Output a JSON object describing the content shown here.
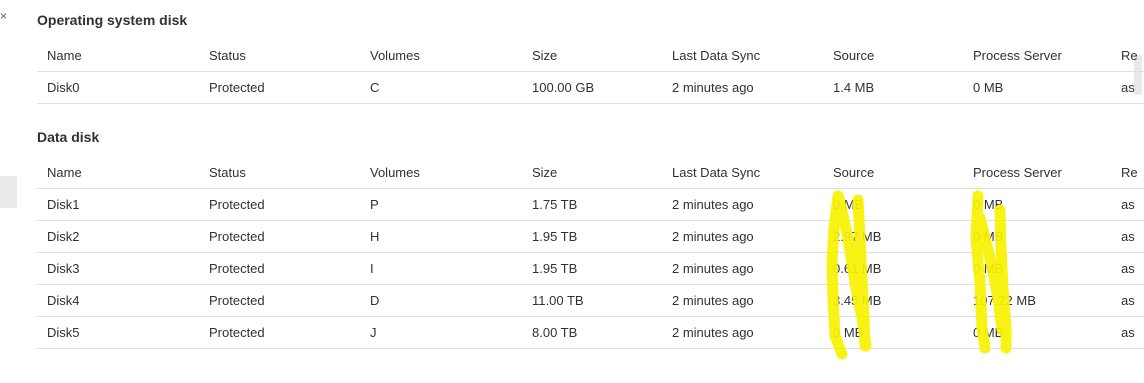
{
  "close_glyph": "×",
  "os_disk": {
    "title": "Operating system disk",
    "columns": [
      "Name",
      "Status",
      "Volumes",
      "Size",
      "Last Data Sync",
      "Source",
      "Process Server",
      "Re"
    ],
    "rows": [
      [
        "Disk0",
        "Protected",
        "C",
        "100.00 GB",
        "2 minutes ago",
        "1.4 MB",
        "0 MB",
        "as"
      ]
    ]
  },
  "data_disk": {
    "title": "Data disk",
    "columns": [
      "Name",
      "Status",
      "Volumes",
      "Size",
      "Last Data Sync",
      "Source",
      "Process Server",
      "Re"
    ],
    "rows": [
      [
        "Disk1",
        "Protected",
        "P",
        "1.75 TB",
        "2 minutes ago",
        "0 MB",
        "0 MB",
        "as"
      ],
      [
        "Disk2",
        "Protected",
        "H",
        "1.95 TB",
        "2 minutes ago",
        "2.97 MB",
        "0 MB",
        "as"
      ],
      [
        "Disk3",
        "Protected",
        "I",
        "1.95 TB",
        "2 minutes ago",
        "0.61 MB",
        "0 MB",
        "as"
      ],
      [
        "Disk4",
        "Protected",
        "D",
        "11.00 TB",
        "2 minutes ago",
        "3.45 MB",
        "107.22 MB",
        "as"
      ],
      [
        "Disk5",
        "Protected",
        "J",
        "8.00 TB",
        "2 minutes ago",
        "0 MB",
        "0 MB",
        "as"
      ]
    ]
  },
  "colors": {
    "highlight": "#f7f200",
    "border": "#e1dfdd",
    "text": "#323130"
  }
}
